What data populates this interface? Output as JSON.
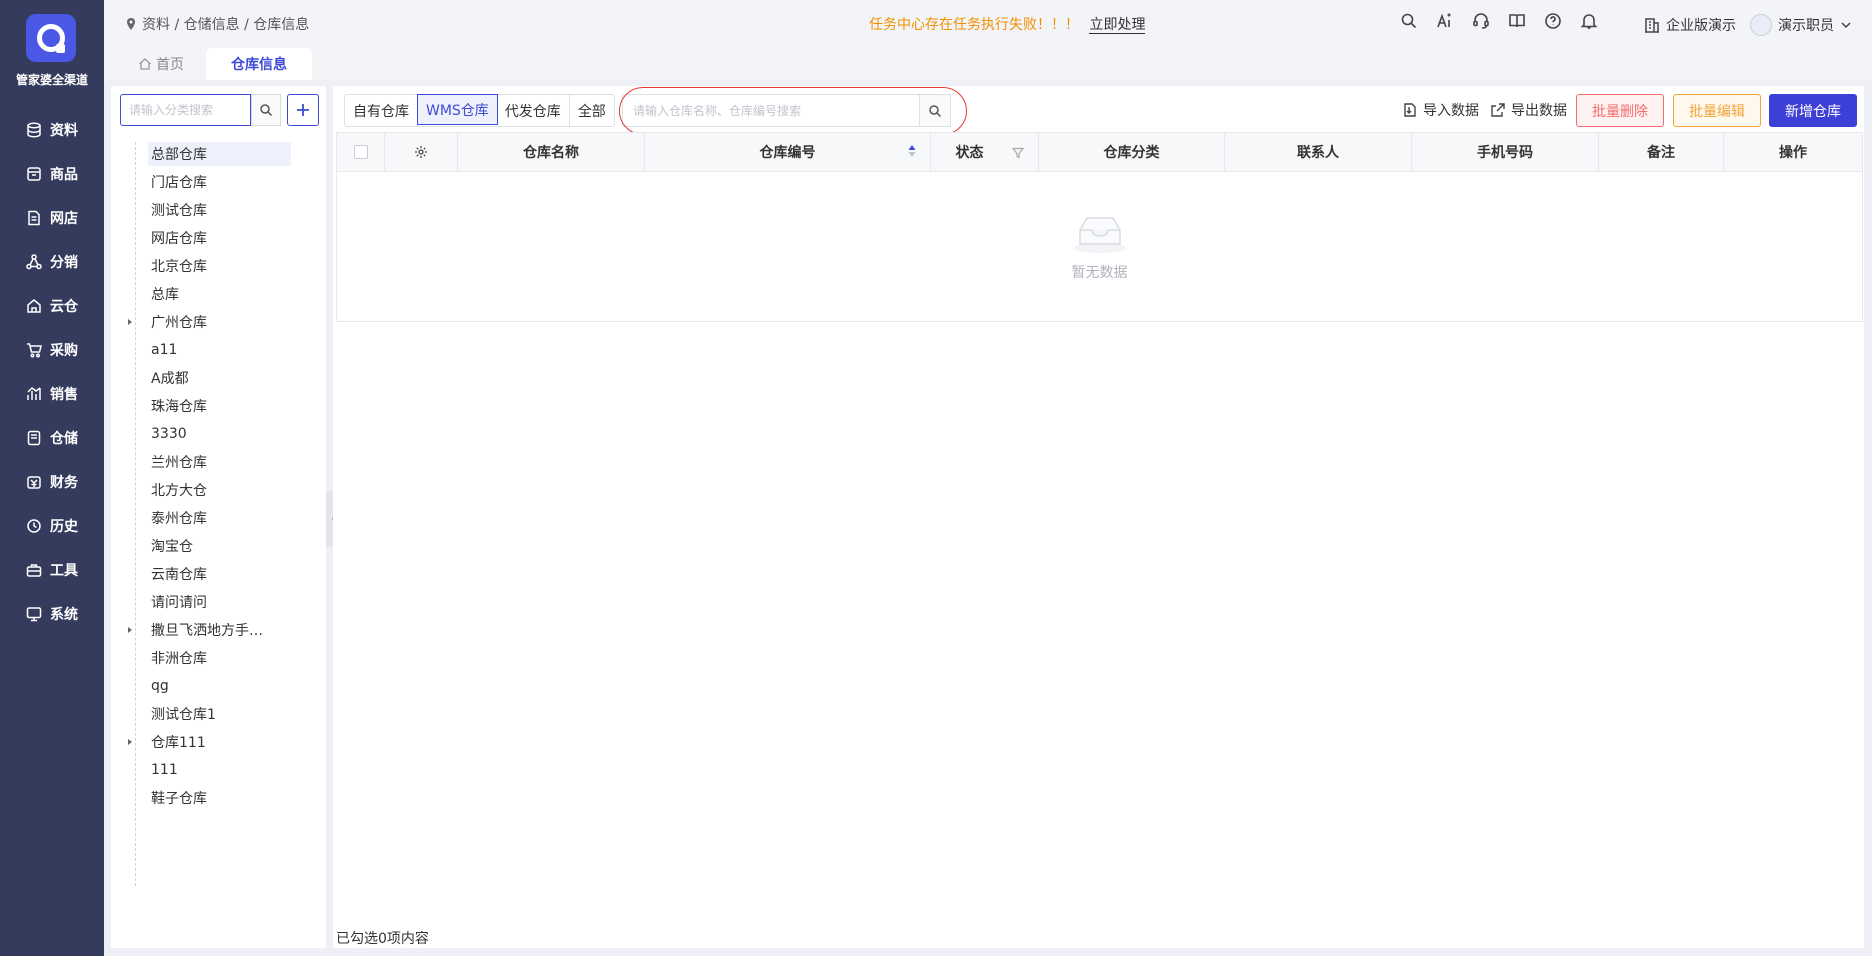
{
  "brand": {
    "name": "管家婆全渠道"
  },
  "nav": [
    {
      "label": "资料",
      "icon": "database-icon"
    },
    {
      "label": "商品",
      "icon": "box-icon"
    },
    {
      "label": "网店",
      "icon": "document-icon"
    },
    {
      "label": "分销",
      "icon": "share-nodes-icon"
    },
    {
      "label": "云仓",
      "icon": "cloud-house-icon"
    },
    {
      "label": "采购",
      "icon": "cart-icon"
    },
    {
      "label": "销售",
      "icon": "chart-icon"
    },
    {
      "label": "仓储",
      "icon": "storage-icon"
    },
    {
      "label": "财务",
      "icon": "wallet-icon"
    },
    {
      "label": "历史",
      "icon": "history-icon"
    },
    {
      "label": "工具",
      "icon": "toolbox-icon"
    },
    {
      "label": "系统",
      "icon": "monitor-icon"
    }
  ],
  "breadcrumb": {
    "text": "资料 / 仓储信息 / 仓库信息"
  },
  "alert": {
    "message": "任务中心存在任务执行失败！！！",
    "action": "立即处理"
  },
  "topbar": {
    "org": "企业版演示",
    "user": "演示职员"
  },
  "tabs": [
    {
      "label": "首页"
    },
    {
      "label": "仓库信息"
    }
  ],
  "tree": {
    "search_placeholder": "请输入分类搜索",
    "items": [
      {
        "label": "总部仓库"
      },
      {
        "label": "门店仓库"
      },
      {
        "label": "测试仓库"
      },
      {
        "label": "网店仓库"
      },
      {
        "label": "北京仓库"
      },
      {
        "label": "总库"
      },
      {
        "label": "广州仓库"
      },
      {
        "label": "a11"
      },
      {
        "label": "A成都"
      },
      {
        "label": "珠海仓库"
      },
      {
        "label": "3330"
      },
      {
        "label": "兰州仓库"
      },
      {
        "label": "北方大仓"
      },
      {
        "label": "泰州仓库"
      },
      {
        "label": "淘宝仓"
      },
      {
        "label": "云南仓库"
      },
      {
        "label": "请问请问"
      },
      {
        "label": "撒旦飞洒地方手…"
      },
      {
        "label": "非洲仓库"
      },
      {
        "label": "qg"
      },
      {
        "label": "测试仓库1"
      },
      {
        "label": "仓库111"
      },
      {
        "label": "111"
      },
      {
        "label": "鞋子仓库"
      }
    ]
  },
  "filters": [
    {
      "label": "自有仓库"
    },
    {
      "label": "WMS仓库"
    },
    {
      "label": "代发仓库"
    },
    {
      "label": "全部"
    }
  ],
  "search": {
    "placeholder": "请输入仓库名称、仓库编号搜索"
  },
  "actions": {
    "import": "导入数据",
    "export": "导出数据",
    "batch_delete": "批量删除",
    "batch_edit": "批量编辑",
    "add": "新增仓库"
  },
  "table": {
    "columns": [
      "仓库名称",
      "仓库编号",
      "状态",
      "仓库分类",
      "联系人",
      "手机号码",
      "备注",
      "操作"
    ],
    "rows": [],
    "empty_text": "暂无数据"
  },
  "footer": {
    "selected_text": "已勾选0项内容"
  }
}
